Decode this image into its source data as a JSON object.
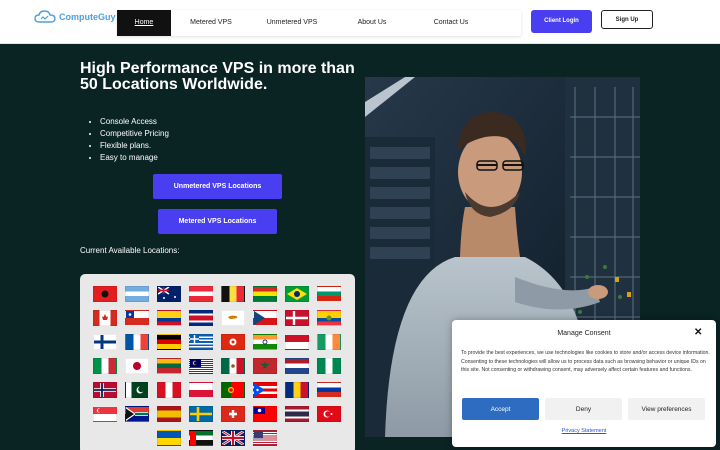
{
  "header": {
    "logo_text": "ComputeGuy",
    "nav": [
      "Home",
      "Metered VPS",
      "Unmetered VPS",
      "About Us",
      "Contact Us"
    ],
    "client_login": "Client Login",
    "sign_up": "Sign Up"
  },
  "hero": {
    "title": "High Performance VPS in more than 50 Locations Worldwide.",
    "features": [
      "Console Access",
      "Competitive Pricing",
      "Flexible plans.",
      "Easy to manage"
    ],
    "unmetered_btn": "Unmetered VPS Locations",
    "metered_btn": "Metered VPS Locations",
    "locations_label": "Current Available Locations:"
  },
  "flags": [
    "albania",
    "argentina",
    "australia",
    "austria",
    "belgium",
    "bolivia",
    "brazil",
    "bulgaria",
    "canada",
    "chile",
    "colombia",
    "costa-rica",
    "cyprus",
    "czechia",
    "denmark",
    "ecuador",
    "finland",
    "france",
    "germany",
    "greece",
    "hong-kong",
    "india",
    "indonesia",
    "ireland",
    "italy",
    "japan",
    "lithuania",
    "malaysia",
    "mexico",
    "morocco",
    "netherlands",
    "nigeria",
    "norway",
    "pakistan",
    "peru",
    "poland",
    "portugal",
    "puerto-rico",
    "romania",
    "russia",
    "singapore",
    "south-africa",
    "spain",
    "sweden",
    "switzerland",
    "taiwan",
    "thailand",
    "turkey",
    "ukraine",
    "uae",
    "united-kingdom",
    "united-states"
  ],
  "consent": {
    "title": "Manage Consent",
    "body": "To provide the best experiences, we use technologies like cookies to store and/or access device information. Consenting to these technologies will allow us to process data such as browsing behavior or unique IDs on this site. Not consenting or withdrawing consent, may adversely affect certain features and functions.",
    "accept": "Accept",
    "deny": "Deny",
    "preferences": "View preferences",
    "policy": "Privacy Statement"
  },
  "colors": {
    "accent": "#4a3ff0",
    "background": "#0a2323",
    "header": "#ffffff"
  }
}
